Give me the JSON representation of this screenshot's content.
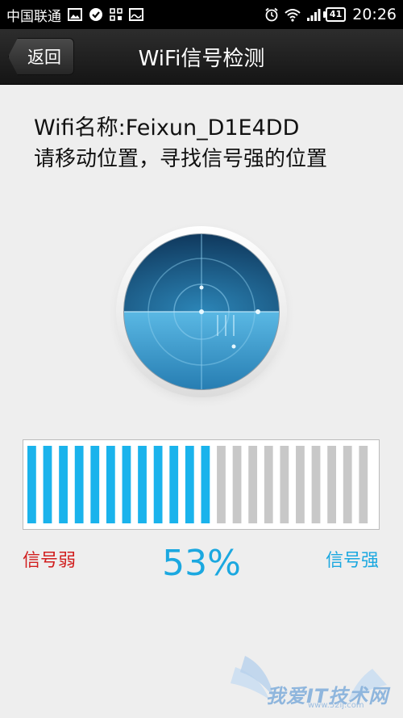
{
  "status_bar": {
    "carrier": "中国联通",
    "time": "20:26",
    "battery": "41",
    "icons": [
      "image-icon",
      "check-circle-icon",
      "grid-icon",
      "image-icon",
      "alarm-icon",
      "wifi-icon",
      "cell-signal-icon",
      "battery-icon"
    ]
  },
  "header": {
    "back_label": "返回",
    "title": "WiFi信号检测"
  },
  "info": {
    "wifi_name": "Wifi名称:Feixun_D1E4DD",
    "instruction": "请移动位置，寻找信号强的位置"
  },
  "signal": {
    "weak_label": "信号弱",
    "strong_label": "信号强",
    "percent_text": "53%",
    "total_segments": 22,
    "active_segments": 12,
    "active_color": "#1ab3ec",
    "inactive_color": "#c8c8c8"
  },
  "watermark": {
    "text": "我爱IT技术网",
    "url": "www.52ij.com"
  }
}
